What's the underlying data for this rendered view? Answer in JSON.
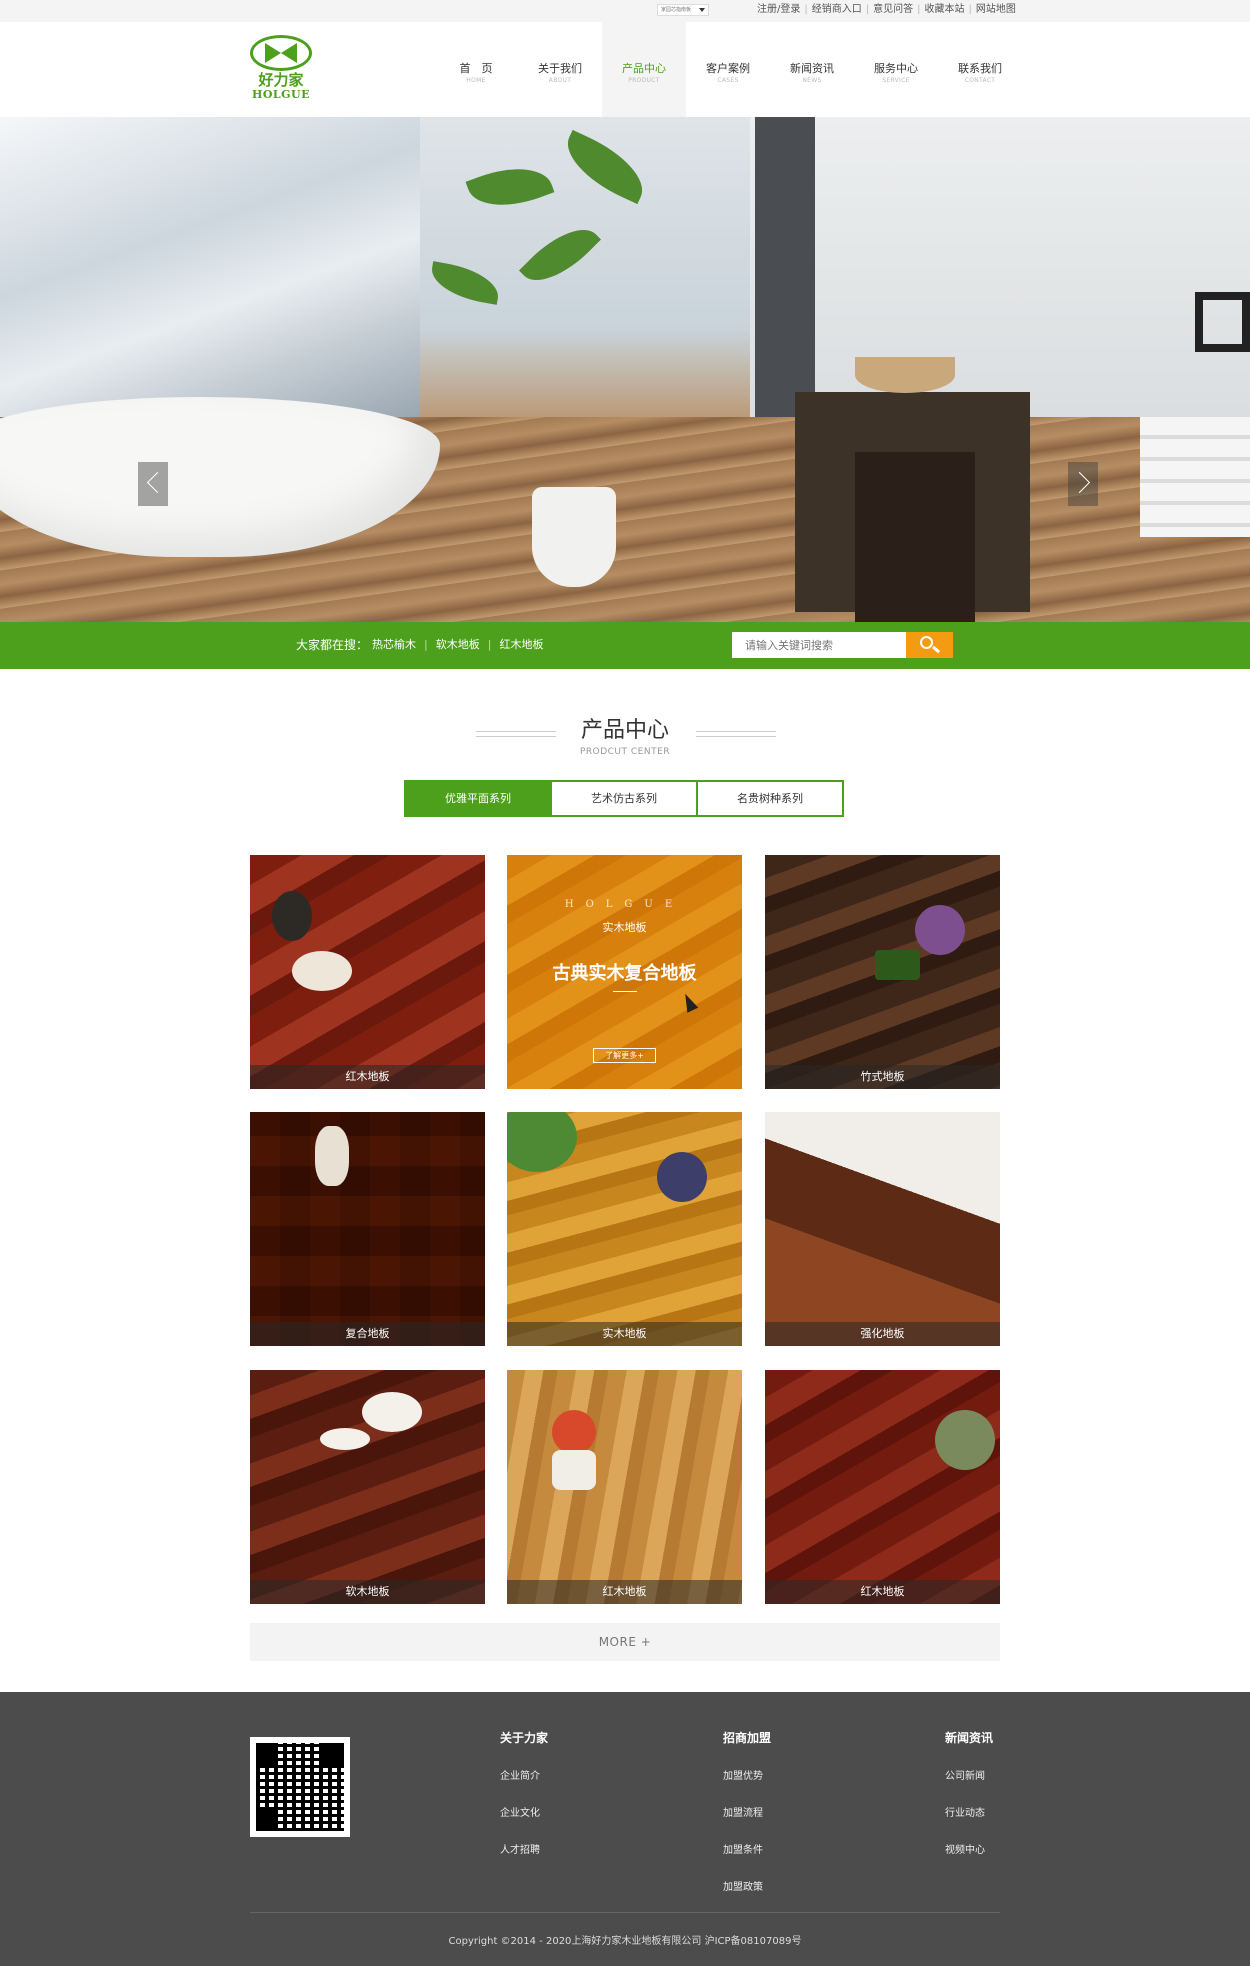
{
  "topbar": {
    "lang_label": "家园芯指南板",
    "links": [
      "注册/登录",
      "经销商入口",
      "意见问答",
      "收藏本站",
      "网站地图"
    ]
  },
  "logo": {
    "cn": "好力家",
    "en": "HOLGUE"
  },
  "nav": [
    {
      "cn": "首　页",
      "en": "HOME",
      "active": false
    },
    {
      "cn": "关于我们",
      "en": "ABOUT",
      "active": false
    },
    {
      "cn": "产品中心",
      "en": "PRODUCT",
      "active": true
    },
    {
      "cn": "客户案例",
      "en": "CASES",
      "active": false
    },
    {
      "cn": "新闻资讯",
      "en": "NEWS",
      "active": false
    },
    {
      "cn": "服务中心",
      "en": "SERVICE",
      "active": false
    },
    {
      "cn": "联系我们",
      "en": "CONTACT",
      "active": false
    }
  ],
  "banner": {
    "slide_count": 5,
    "active_slide": 3
  },
  "search": {
    "hot_label": "大家都在搜：",
    "hot_terms": [
      "热芯榆木",
      "软木地板",
      "红木地板"
    ],
    "placeholder": "请输入关键词搜索"
  },
  "section": {
    "title": "产品中心",
    "subtitle": "PRODCUT CENTER"
  },
  "tabs": [
    "优雅平面系列",
    "艺术仿古系列",
    "名贵树种系列"
  ],
  "products": [
    {
      "caption": "红木地板"
    },
    {
      "caption": ""
    },
    {
      "caption": "竹式地板"
    },
    {
      "caption": "复合地板"
    },
    {
      "caption": "实木地板"
    },
    {
      "caption": "强化地板"
    },
    {
      "caption": "软木地板"
    },
    {
      "caption": "红木地板"
    },
    {
      "caption": "红木地板"
    }
  ],
  "promo": {
    "brand": "HOLGUE",
    "sub": "实木地板",
    "big": "古典实木复合地板",
    "more": "了解更多+"
  },
  "more_label": "MORE +",
  "footer": {
    "cols": [
      {
        "title": "关于力家",
        "links": [
          "企业简介",
          "企业文化",
          "人才招聘"
        ]
      },
      {
        "title": "招商加盟",
        "links": [
          "加盟优势",
          "加盟流程",
          "加盟条件",
          "加盟政策"
        ]
      },
      {
        "title": "新闻资讯",
        "links": [
          "公司新闻",
          "行业动态",
          "视频中心"
        ]
      }
    ],
    "copyright": "Copyright ©2014 - 2020上海好力家木业地板有限公司  沪ICP备08107089号"
  },
  "colors": {
    "brand_green": "#4da01c",
    "accent_orange": "#f39c12",
    "footer_bg": "#4c4c4c"
  }
}
